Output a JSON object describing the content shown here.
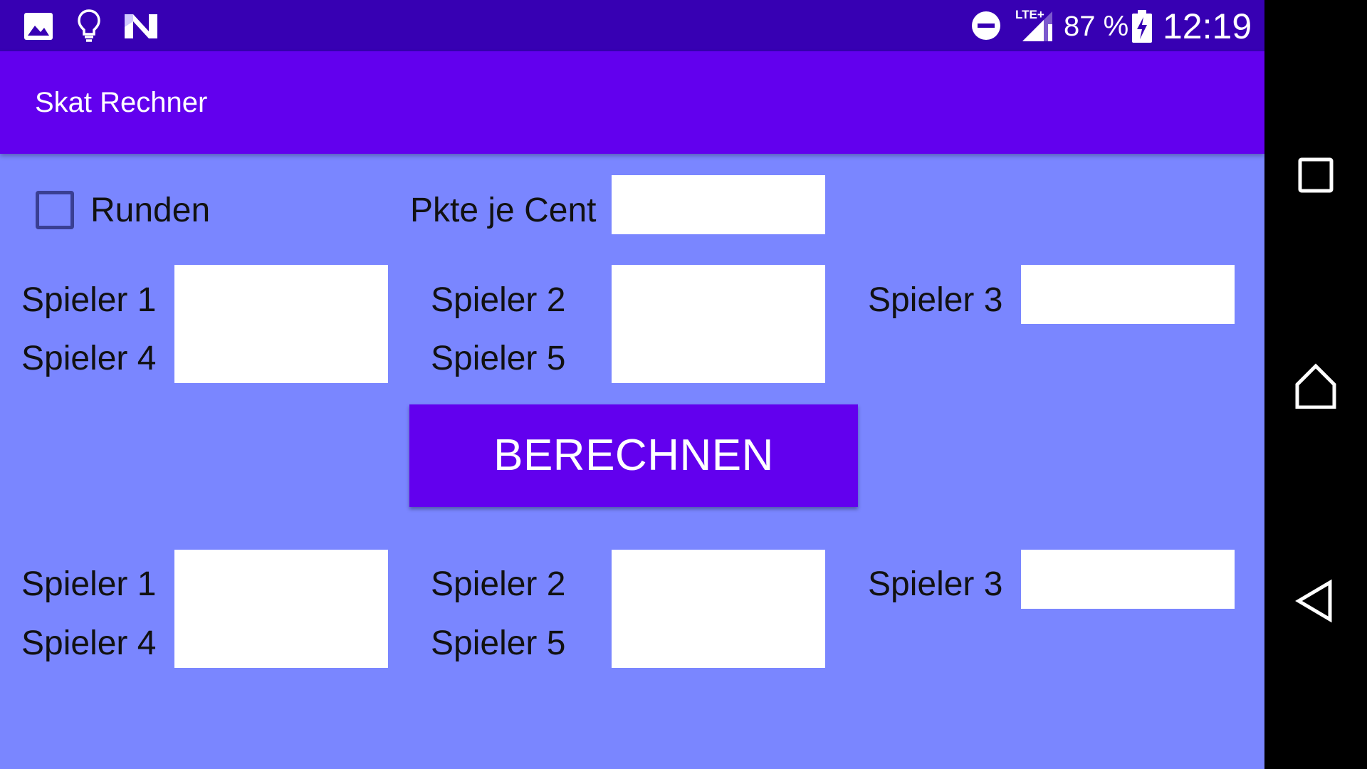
{
  "status_bar": {
    "battery_percent": "87 %",
    "time": "12:19",
    "network_type": "LTE+",
    "icons": [
      "image-icon",
      "lightbulb-icon",
      "n-logo-icon",
      "do-not-disturb-icon",
      "signal-icon",
      "battery-charging-icon"
    ],
    "background_color": "#3700b3"
  },
  "app_bar": {
    "title": "Skat Rechner",
    "background_color": "#6200ee"
  },
  "options": {
    "runden_label": "Runden",
    "runden_checked": false,
    "pkte_je_cent_label": "Pkte je Cent",
    "pkte_je_cent_value": ""
  },
  "input_section": {
    "labels": {
      "spieler1": "Spieler 1",
      "spieler2": "Spieler 2",
      "spieler3": "Spieler 3",
      "spieler4": "Spieler 4",
      "spieler5": "Spieler 5"
    },
    "values": {
      "spieler1": "",
      "spieler2": "",
      "spieler3": "",
      "spieler4": "",
      "spieler5": ""
    }
  },
  "calculate_button": {
    "label": "BERECHNEN",
    "color": "#6200ee"
  },
  "result_section": {
    "labels": {
      "spieler1": "Spieler 1",
      "spieler2": "Spieler 2",
      "spieler3": "Spieler 3",
      "spieler4": "Spieler 4",
      "spieler5": "Spieler 5"
    },
    "values": {
      "spieler1": "",
      "spieler2": "",
      "spieler3": "",
      "spieler4": "",
      "spieler5": ""
    }
  },
  "navigation_bar": {
    "buttons": [
      "recents-square-icon",
      "home-icon",
      "back-triangle-icon"
    ]
  },
  "colors": {
    "content_background": "#7a86ff",
    "field_background": "#ffffff",
    "text": "#111111"
  }
}
